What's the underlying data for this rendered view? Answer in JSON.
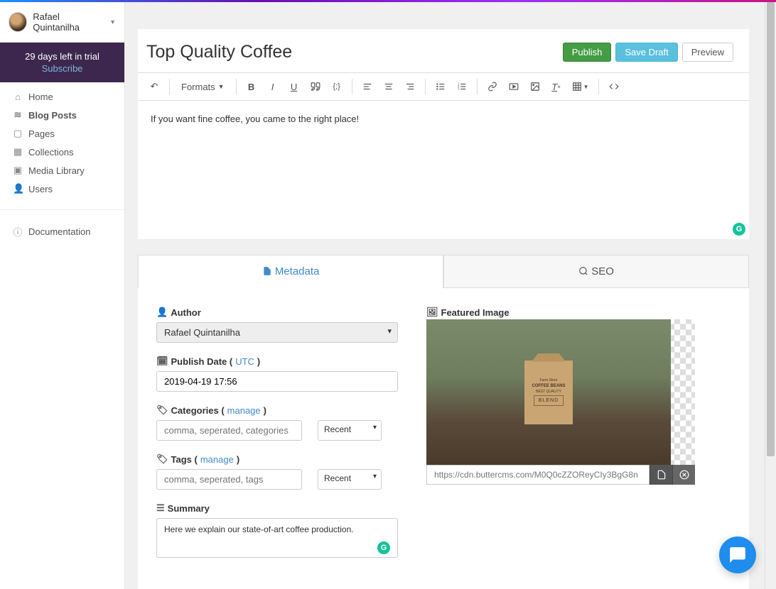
{
  "user": {
    "name": "Rafael Quintanilha"
  },
  "trial": {
    "text": "29 days left in trial",
    "subscribe": "Subscribe"
  },
  "nav": {
    "home": "Home",
    "blog_posts": "Blog Posts",
    "pages": "Pages",
    "collections": "Collections",
    "media": "Media Library",
    "users": "Users",
    "docs": "Documentation"
  },
  "post": {
    "title": "Top Quality Coffee",
    "content": "If you want fine coffee, you came to the right place!"
  },
  "buttons": {
    "publish": "Publish",
    "save_draft": "Save Draft",
    "preview": "Preview"
  },
  "toolbar": {
    "formats": "Formats"
  },
  "tabs": {
    "metadata": "Metadata",
    "seo": "SEO"
  },
  "metadata": {
    "author_label": "Author",
    "author_value": "Rafael Quintanilha",
    "publish_label_prefix": "Publish Date (",
    "publish_label_link": "UTC",
    "publish_label_suffix": ")",
    "publish_value": "2019-04-19 17:56",
    "categories_label_prefix": "Categories (",
    "categories_manage": "manage",
    "categories_label_suffix": ")",
    "categories_placeholder": "comma, seperated, categories",
    "tags_label_prefix": "Tags (",
    "tags_manage": "manage",
    "tags_label_suffix": ")",
    "tags_placeholder": "comma, seperated, tags",
    "recent": "Recent",
    "summary_label": "Summary",
    "summary_value": "Here we explain our state-of-art coffee production.",
    "featured_label": "Featured Image",
    "featured_url": "https://cdn.buttercms.com/M0Q0cZZOReyCIy3BgG8n"
  },
  "coffee_bag": {
    "brand": "Farm Store",
    "product": "COFFEE BEANS",
    "quality": "BEST QUALITY",
    "blend": "BLEND"
  }
}
